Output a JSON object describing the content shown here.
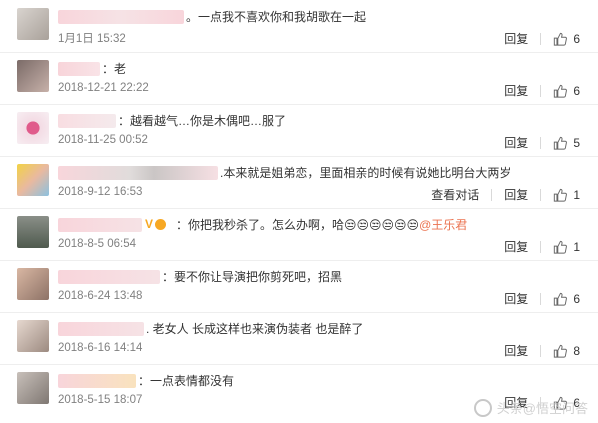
{
  "comments": [
    {
      "text": "。一点我不喜欢你和我胡歌在一起",
      "time": "1月1日 15:32",
      "reply": "回复",
      "likes": "6"
    },
    {
      "text": "：老",
      "time": "2018-12-21 22:22",
      "reply": "回复",
      "likes": "6"
    },
    {
      "text": "：越看越气…你是木偶吧…服了",
      "time": "2018-11-25 00:52",
      "reply": "回复",
      "likes": "5"
    },
    {
      "text": ".本来就是姐弟恋，里面相亲的时候有说她比明台大两岁",
      "time": "2018-9-12 16:53",
      "view_dialog": "查看对话",
      "reply": "回复",
      "likes": "1"
    },
    {
      "text_before": "：你把我秒杀了。怎么办啊，哈😒😒😒😒😒😒",
      "mention": "@王乐君",
      "time": "2018-8-5 06:54",
      "reply": "回复",
      "likes": "1"
    },
    {
      "text": "：要不你让导演把你剪死吧，招黑",
      "time": "2018-6-24 13:48",
      "reply": "回复",
      "likes": "6"
    },
    {
      "text": ". 老女人 长成这样也来演伪装者 也是醉了",
      "time": "2018-6-16 14:14",
      "reply": "回复",
      "likes": "8"
    },
    {
      "text": "：一点表情都没有",
      "time": "2018-5-15 18:07",
      "reply": "回复",
      "likes": "6"
    }
  ],
  "watermark": "头条@悟空问答",
  "colors": {
    "mention": "#eb7350",
    "time": "#808080",
    "vip": "#f7a823"
  }
}
